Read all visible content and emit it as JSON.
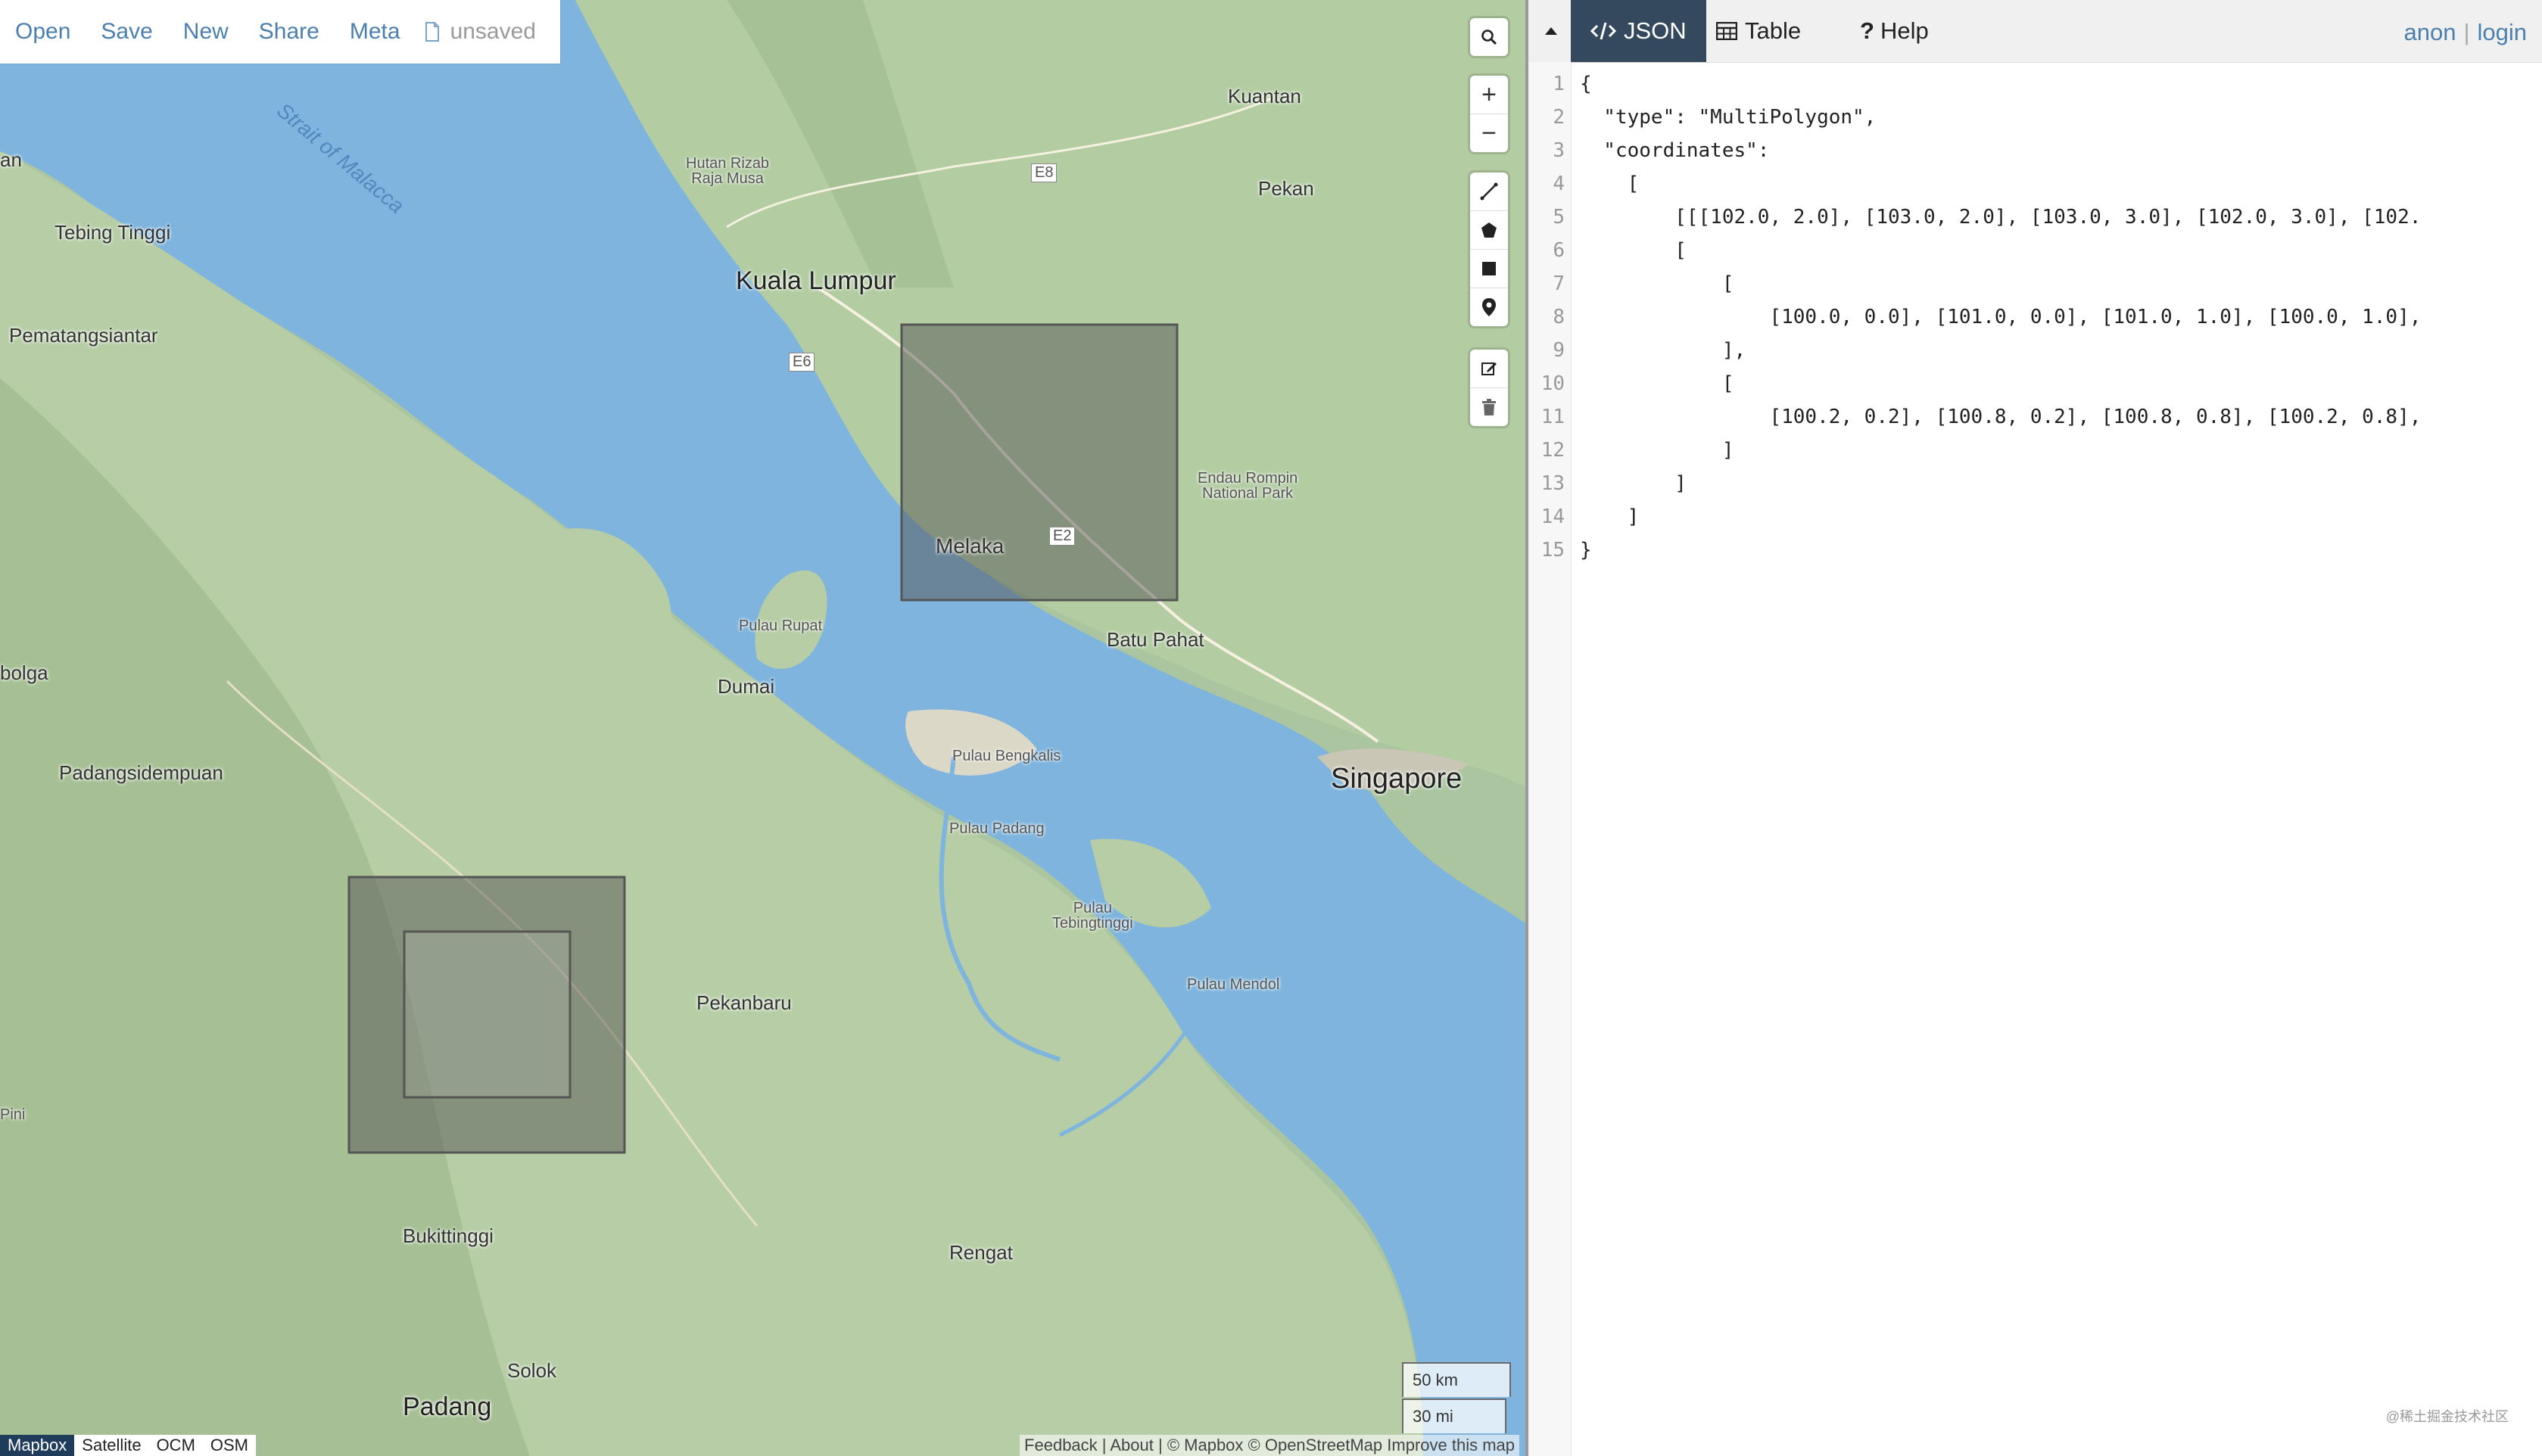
{
  "menu": {
    "items": [
      "Open",
      "Save",
      "New",
      "Share",
      "Meta"
    ],
    "file_status": "unsaved"
  },
  "map": {
    "controls": {
      "search_icon": "search-icon",
      "zoom_in": "+",
      "zoom_out": "−",
      "draw_tools": [
        "line-icon",
        "polygon-icon",
        "rectangle-icon",
        "marker-icon"
      ],
      "edit_tools": [
        "edit-icon",
        "trash-icon"
      ]
    },
    "labels": {
      "strait": "Strait of Malacca",
      "kuantan": "Kuantan",
      "hutan_rizab": "Hutan Rizab\nRaja Musa",
      "pekan": "Pekan",
      "kuala_lumpur": "Kuala Lumpur",
      "tebing_tinggi": "Tebing Tinggi",
      "pematangsiantar": "Pematangsiantar",
      "an": "an",
      "melaka": "Melaka",
      "endau_rompin": "Endau Rompin\nNational Park",
      "pulau_rupat": "Pulau Rupat",
      "batu_pahat": "Batu Pahat",
      "dumai": "Dumai",
      "bolga": "bolga",
      "pulau_bengkalis": "Pulau Bengkalis",
      "singapore": "Singapore",
      "padangsidempuan": "Padangsidempuan",
      "pulau_padang": "Pulau Padang",
      "pulau_tebingtinggi": "Pulau\nTebingtinggi",
      "pulau_mendol": "Pulau Mendol",
      "pekanbaru": "Pekanbaru",
      "pini": "Pini",
      "bukittinggi": "Bukittinggi",
      "rengat": "Rengat",
      "solok": "Solok",
      "padang": "Padang",
      "e8": "E8",
      "e6": "E6",
      "e2": "E2"
    },
    "scale": {
      "km": "50 km",
      "mi": "30 mi"
    },
    "layers": [
      "Mapbox",
      "Satellite",
      "OCM",
      "OSM"
    ],
    "attribution": "Feedback | About | © Mapbox © OpenStreetMap Improve this map"
  },
  "panel": {
    "tabs": [
      {
        "label": "JSON",
        "icon": "code-icon"
      },
      {
        "label": "Table",
        "icon": "table-icon"
      },
      {
        "label": "Help",
        "icon": "question-icon"
      }
    ],
    "user": {
      "name": "anon",
      "sep": "|",
      "login": "login"
    },
    "line_numbers": [
      "1",
      "2",
      "3",
      "4",
      "5",
      "6",
      "7",
      "8",
      "9",
      "10",
      "11",
      "12",
      "13",
      "14",
      "15"
    ],
    "code_lines": [
      "{",
      "  \"type\": \"MultiPolygon\",",
      "  \"coordinates\":",
      "    [",
      "        [[[102.0, 2.0], [103.0, 2.0], [103.0, 3.0], [102.0, 3.0], [102.",
      "        [",
      "            [",
      "                [100.0, 0.0], [101.0, 0.0], [101.0, 1.0], [100.0, 1.0],",
      "            ],",
      "            [",
      "                [100.2, 0.2], [100.8, 0.2], [100.8, 0.8], [100.2, 0.8],",
      "            ]",
      "        ]",
      "    ]",
      "}"
    ],
    "watermark": "@稀土掘金技术社区"
  }
}
